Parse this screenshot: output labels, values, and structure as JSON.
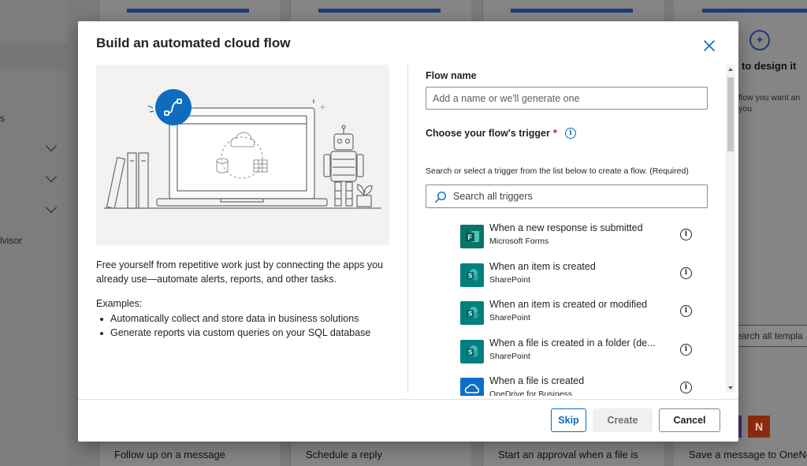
{
  "background": {
    "left_nav": {
      "partial_labels": [
        "s",
        "lvisor"
      ]
    },
    "cards": [
      {
        "footer": "Follow up on a message"
      },
      {
        "footer": "Schedule a reply"
      },
      {
        "footer": "Start an approval when a file is"
      }
    ],
    "right_card": {
      "title": "to design it",
      "desc": "flow you want an\nyou",
      "search_text": "earch all templa",
      "onenote_glyph": "N",
      "footer": "Save a message to OneNo"
    }
  },
  "dialog": {
    "title": "Build an automated cloud flow",
    "intro": "Free yourself from repetitive work just by connecting the apps you already use—automate alerts, reports, and other tasks.",
    "examples_heading": "Examples:",
    "examples": [
      "Automatically collect and store data in business solutions",
      "Generate reports via custom queries on your SQL database"
    ],
    "flow_name": {
      "label": "Flow name",
      "placeholder": "Add a name or we'll generate one",
      "value": ""
    },
    "trigger": {
      "label": "Choose your flow's trigger",
      "required_mark": "*",
      "help": "Search or select a trigger from the list below to create a flow. (Required)",
      "search_placeholder": "Search all triggers",
      "items": [
        {
          "name": "When a new response is submitted",
          "connector": "Microsoft Forms",
          "icon": "microsoft-forms-icon"
        },
        {
          "name": "When an item is created",
          "connector": "SharePoint",
          "icon": "sharepoint-icon"
        },
        {
          "name": "When an item is created or modified",
          "connector": "SharePoint",
          "icon": "sharepoint-icon"
        },
        {
          "name": "When a file is created in a folder (de...",
          "connector": "SharePoint",
          "icon": "sharepoint-icon"
        },
        {
          "name": "When a file is created",
          "connector": "OneDrive for Business",
          "icon": "onedrive-icon"
        }
      ]
    },
    "buttons": {
      "skip": "Skip",
      "create": "Create",
      "cancel": "Cancel"
    },
    "colors": {
      "accent": "#0f6cbd",
      "forms": "#077568",
      "sharepoint": "#037f7f",
      "onedrive": "#0f6fc6"
    }
  }
}
